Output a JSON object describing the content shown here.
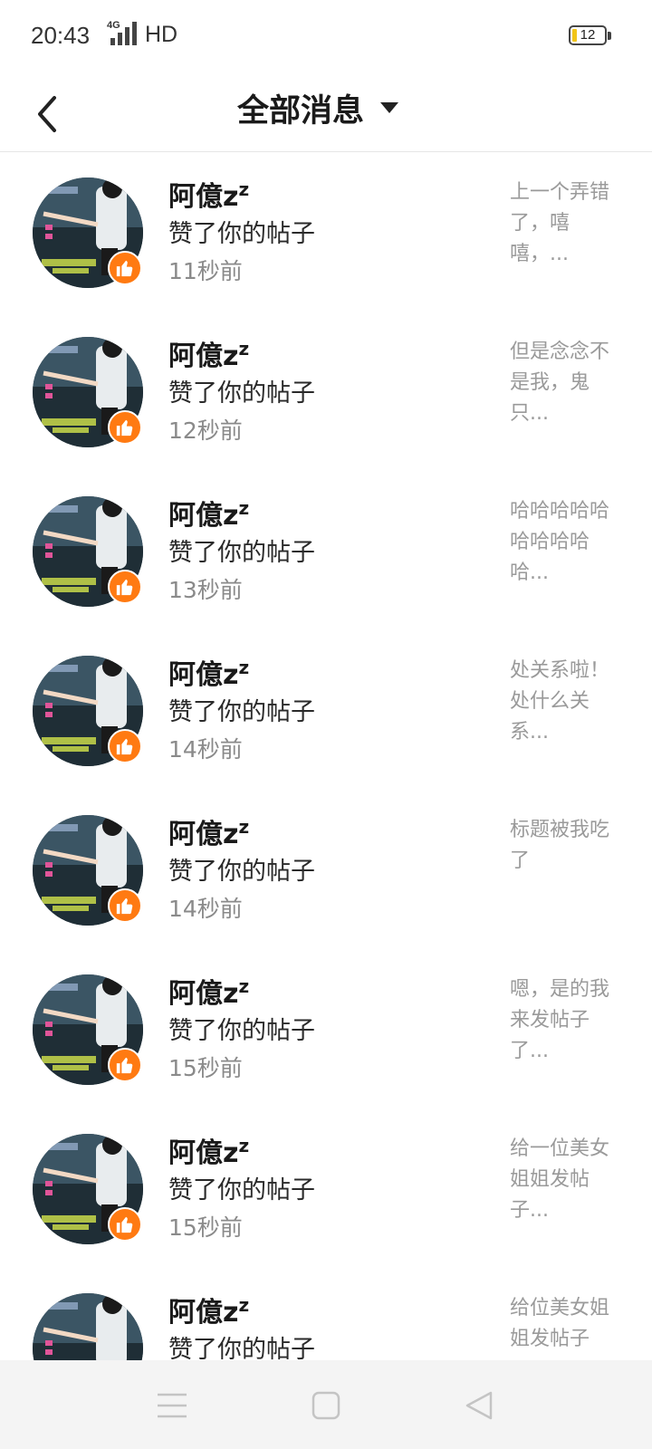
{
  "status_bar": {
    "time": "20:43",
    "network": "4G",
    "hd": "HD",
    "battery": "12"
  },
  "header": {
    "title": "全部消息"
  },
  "colors": {
    "accent": "#ff7a12",
    "text_primary": "#1a1a1a",
    "text_secondary": "#8a8a8a",
    "nav_bar": "#f4f4f4"
  },
  "notifications": [
    {
      "user": "阿億z",
      "sup": "z",
      "action": "赞了你的帖子",
      "time": "11秒前",
      "snippet": "上一个弄错了，嘻嘻，..."
    },
    {
      "user": "阿億z",
      "sup": "z",
      "action": "赞了你的帖子",
      "time": "12秒前",
      "snippet": "但是念念不是我，鬼只..."
    },
    {
      "user": "阿億z",
      "sup": "z",
      "action": "赞了你的帖子",
      "time": "13秒前",
      "snippet": "哈哈哈哈哈哈哈哈哈哈..."
    },
    {
      "user": "阿億z",
      "sup": "z",
      "action": "赞了你的帖子",
      "time": "14秒前",
      "snippet": "处关系啦！处什么关系..."
    },
    {
      "user": "阿億z",
      "sup": "z",
      "action": "赞了你的帖子",
      "time": "14秒前",
      "snippet": "标题被我吃了"
    },
    {
      "user": "阿億z",
      "sup": "z",
      "action": "赞了你的帖子",
      "time": "15秒前",
      "snippet": "嗯，是的我来发帖子了..."
    },
    {
      "user": "阿億z",
      "sup": "z",
      "action": "赞了你的帖子",
      "time": "15秒前",
      "snippet": "给一位美女姐姐发帖子..."
    },
    {
      "user": "阿億z",
      "sup": "z",
      "action": "赞了你的帖子",
      "time": "",
      "snippet": "给位美女姐姐发帖子"
    }
  ],
  "nav": {
    "icons": [
      "menu-icon",
      "home-square-icon",
      "back-triangle-icon"
    ]
  }
}
